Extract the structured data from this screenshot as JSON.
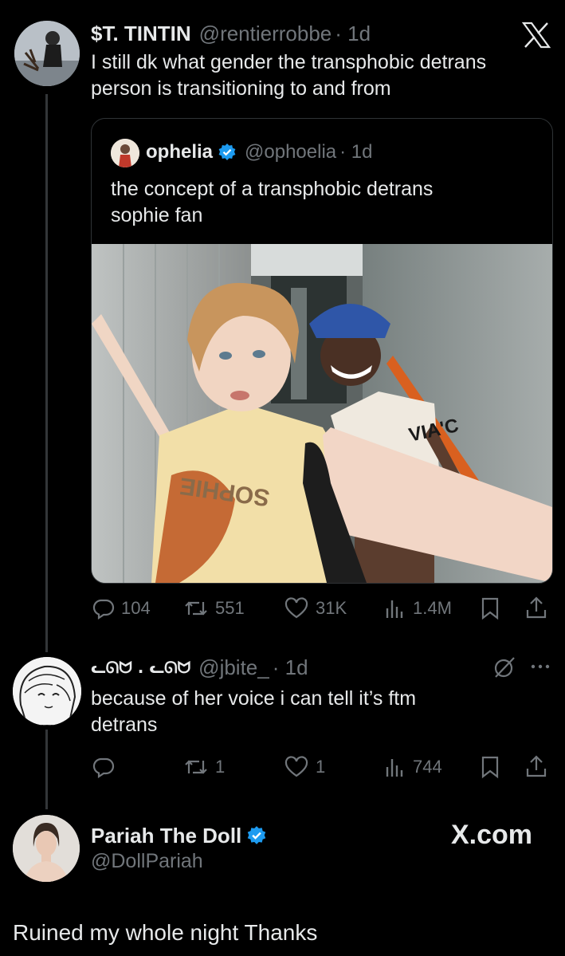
{
  "colors": {
    "accent": "#1d9bf0",
    "muted": "#71767b",
    "text": "#e7e9ea",
    "border": "#2f3336"
  },
  "tweet1": {
    "display_name": "$T. TINTIN",
    "handle": "@rentierrobbe",
    "time": "· 1d",
    "text_line1": "I still dk what gender the transphobic detrans",
    "text_line2": "person is transitioning to and from",
    "brand_icon": "x-logo-icon"
  },
  "quote": {
    "display_name": "ophelia",
    "handle": "@ophoelia",
    "time": "· 1d",
    "text_line1": "the concept of a transphobic detrans",
    "text_line2": "sophie fan",
    "photo_shirt_text": "SOPHIE",
    "photo_shirt_text2": "VIA'C"
  },
  "tweet1_metrics": {
    "replies": "104",
    "reposts": "551",
    "likes": "31K",
    "views": "1.4M"
  },
  "tweet2": {
    "display_name": "ᓚᘏᗢ . ᓚᘏᗢ",
    "handle": "@jbite_",
    "time": "· 1d",
    "text_line1": "because of her voice i can tell it’s ftm",
    "text_line2": "detrans"
  },
  "tweet2_metrics": {
    "replies": "",
    "reposts": "1",
    "likes": "1",
    "views": "744"
  },
  "profile": {
    "display_name": "Pariah The Doll",
    "handle": "@DollPariah",
    "site": "X.com"
  },
  "caption": "Ruined my whole night Thanks"
}
